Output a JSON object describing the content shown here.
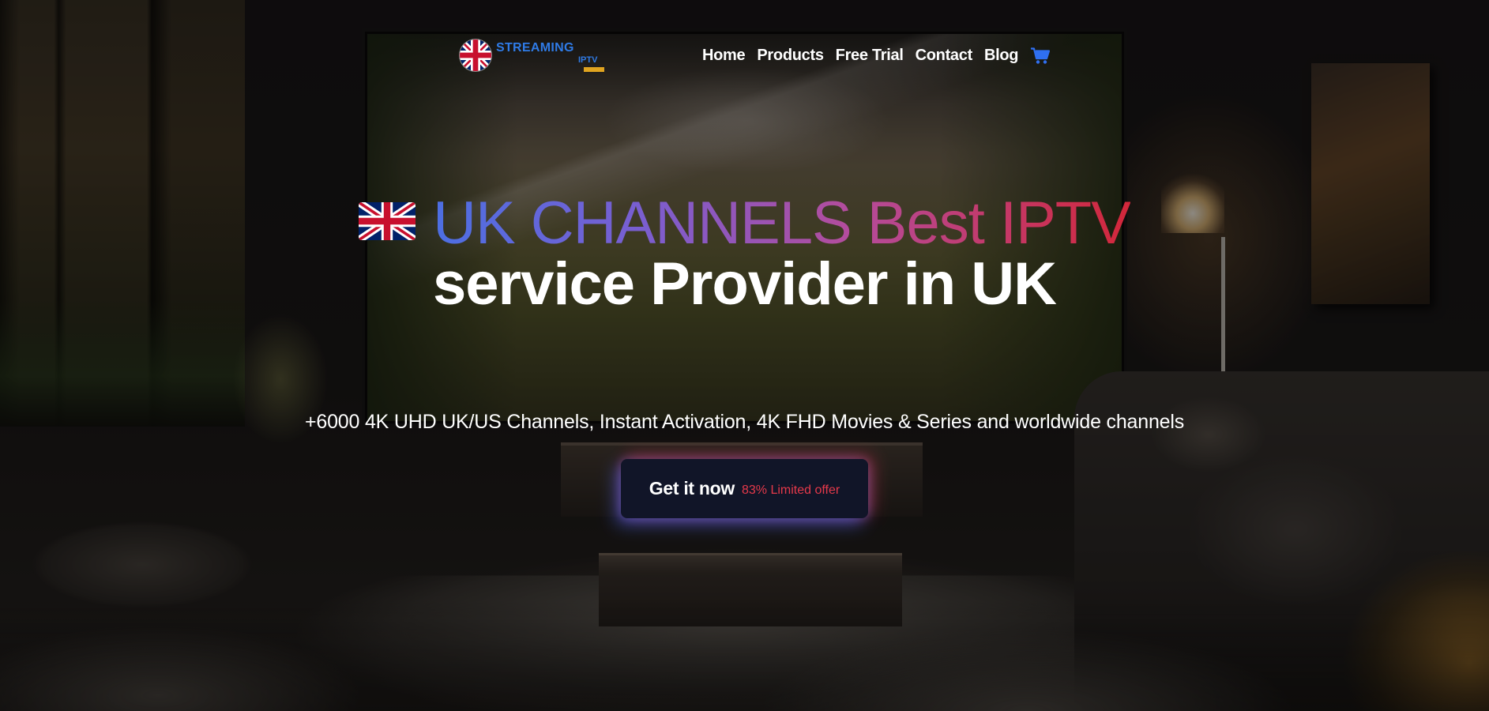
{
  "header": {
    "logo": {
      "name": "STREAMING",
      "sub": "IPTV"
    },
    "nav": [
      {
        "label": "Home"
      },
      {
        "label": "Products"
      },
      {
        "label": "Free Trial"
      },
      {
        "label": "Contact"
      },
      {
        "label": "Blog"
      }
    ],
    "cart_icon": "shopping-cart-icon"
  },
  "hero": {
    "flag_icon": "uk-flag-icon",
    "title_highlight": "UK CHANNELS Best IPTV",
    "title_rest": "service Provider in UK",
    "subtitle": "+6000 4K UHD UK/US Channels, Instant Activation, 4K FHD Movies & Series and worldwide channels",
    "cta": {
      "label": "Get it now",
      "offer": "83% Limited offer"
    }
  },
  "colors": {
    "accent_blue": "#2f7be6",
    "gradient_start": "#4c6fe3",
    "gradient_end": "#d2273a",
    "cta_bg": "#111528",
    "offer_red": "#e5394a"
  }
}
